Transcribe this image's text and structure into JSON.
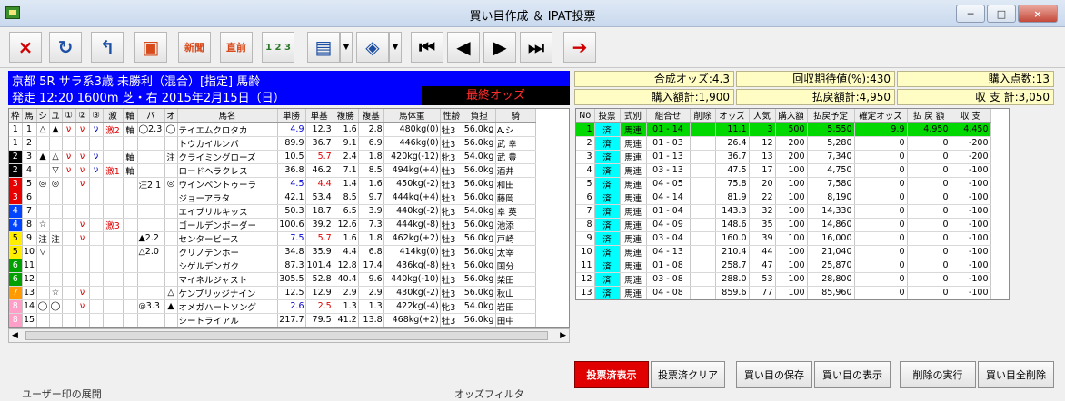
{
  "window": {
    "title": "買い目作成 ＆ IPAT投票",
    "minimize_label": "─",
    "maximize_label": "□",
    "close_label": "×"
  },
  "toolbar": {
    "close_glyph": "×",
    "refresh_glyph": "↻",
    "undo_glyph": "↰",
    "window_glyph": "▣",
    "shinbun_label": "新聞",
    "chokuzen_label": "直前",
    "list_label": "1 2 3",
    "doc_glyph": "▤",
    "dropdown_glyph": "▼",
    "bet_glyph": "◈",
    "first_glyph": "⏮",
    "prev_glyph": "◀",
    "next_glyph": "▶",
    "last_glyph": "⏭",
    "run_glyph": "➔"
  },
  "race": {
    "line1": "京都  5R  サラ系3歳  未勝利（混合）[指定]  馬齢",
    "line2": "発走  12:20  1600m  芝・右      2015年2月15日（日）",
    "odds_status": "最終オッズ"
  },
  "summary": {
    "gosei_odds": "合成オッズ:4.3",
    "kaishu": "回収期待値(%):430",
    "points": "購入点数:13",
    "total_buy": "購入額計:1,900",
    "total_refund": "払戻額計:4,950",
    "balance": "収 支 計:3,050"
  },
  "horse_table": {
    "headers": [
      "枠",
      "馬",
      "シ",
      "ユ",
      "①",
      "②",
      "③",
      "激",
      "軸",
      "バ",
      "オ",
      "馬名",
      "単勝",
      "単基",
      "複勝",
      "複基",
      "馬体重",
      "性齢",
      "負担",
      "騎"
    ],
    "rows": [
      {
        "waku": "1",
        "no": "1",
        "c1": "△",
        "c2": "▲",
        "c3": "ν",
        "c4": "ν",
        "c5": "ν",
        "geki": "激2",
        "jiku": "軸",
        "ba": "◯2.3",
        "o": "◯",
        "name": "テイエムクロタカ",
        "tan": "4.9",
        "tank": "12.3",
        "fuku": "1.6",
        "fukuk": "2.8",
        "weight": "480kg(0)",
        "sex": "牡3",
        "load": "56.0kg",
        "jockey": "A.シ"
      },
      {
        "waku": "1",
        "no": "2",
        "c1": "",
        "c2": "",
        "c3": "",
        "c4": "",
        "c5": "",
        "geki": "",
        "jiku": "",
        "ba": "",
        "o": "",
        "name": "トウカイルンバ",
        "tan": "89.9",
        "tank": "36.7",
        "fuku": "9.1",
        "fukuk": "6.9",
        "weight": "446kg(0)",
        "sex": "牡3",
        "load": "56.0kg",
        "jockey": "武 幸"
      },
      {
        "waku": "2",
        "no": "3",
        "c1": "▲",
        "c2": "△",
        "c3": "ν",
        "c4": "ν",
        "c5": "ν",
        "geki": "",
        "jiku": "軸",
        "ba": "",
        "o": "注",
        "name": "クライミングローズ",
        "tan": "10.5",
        "tank": "5.7",
        "fuku": "2.4",
        "fukuk": "1.8",
        "weight": "420kg(-12)",
        "sex": "牝3",
        "load": "54.0kg",
        "jockey": "武 豊"
      },
      {
        "waku": "2",
        "no": "4",
        "c1": "",
        "c2": "▽",
        "c3": "ν",
        "c4": "ν",
        "c5": "ν",
        "geki": "激1",
        "jiku": "軸",
        "ba": "",
        "o": "",
        "name": "ロードヘラクレス",
        "tan": "36.8",
        "tank": "46.2",
        "fuku": "7.1",
        "fukuk": "8.5",
        "weight": "494kg(+4)",
        "sex": "牡3",
        "load": "56.0kg",
        "jockey": "酒井"
      },
      {
        "waku": "3",
        "no": "5",
        "c1": "◎",
        "c2": "◎",
        "c3": "",
        "c4": "ν",
        "c5": "",
        "geki": "",
        "jiku": "",
        "ba": "注2.1",
        "o": "◎",
        "name": "ウインベントゥーラ",
        "tan": "4.5",
        "tank": "4.4",
        "fuku": "1.4",
        "fukuk": "1.6",
        "weight": "450kg(-2)",
        "sex": "牡3",
        "load": "56.0kg",
        "jockey": "和田"
      },
      {
        "waku": "3",
        "no": "6",
        "c1": "",
        "c2": "",
        "c3": "",
        "c4": "",
        "c5": "",
        "geki": "",
        "jiku": "",
        "ba": "",
        "o": "",
        "name": "ジョーアラタ",
        "tan": "42.1",
        "tank": "53.4",
        "fuku": "8.5",
        "fukuk": "9.7",
        "weight": "444kg(+4)",
        "sex": "牡3",
        "load": "56.0kg",
        "jockey": "藤岡"
      },
      {
        "waku": "4",
        "no": "7",
        "c1": "",
        "c2": "",
        "c3": "",
        "c4": "",
        "c5": "",
        "geki": "",
        "jiku": "",
        "ba": "",
        "o": "",
        "name": "エイブリルキッス",
        "tan": "50.3",
        "tank": "18.7",
        "fuku": "6.5",
        "fukuk": "3.9",
        "weight": "440kg(-2)",
        "sex": "牝3",
        "load": "54.0kg",
        "jockey": "幸 英"
      },
      {
        "waku": "4",
        "no": "8",
        "c1": "☆",
        "c2": "",
        "c3": "",
        "c4": "ν",
        "c5": "",
        "geki": "激3",
        "jiku": "",
        "ba": "",
        "o": "",
        "name": "ゴールデンボーダー",
        "tan": "100.6",
        "tank": "39.2",
        "fuku": "12.6",
        "fukuk": "7.3",
        "weight": "444kg(-8)",
        "sex": "牡3",
        "load": "56.0kg",
        "jockey": "池添"
      },
      {
        "waku": "5",
        "no": "9",
        "c1": "注",
        "c2": "注",
        "c3": "",
        "c4": "ν",
        "c5": "",
        "geki": "",
        "jiku": "",
        "ba": "▲2.2",
        "o": "",
        "name": "センタービース",
        "tan": "7.5",
        "tank": "5.7",
        "fuku": "1.6",
        "fukuk": "1.8",
        "weight": "462kg(+2)",
        "sex": "牡3",
        "load": "56.0kg",
        "jockey": "戸崎"
      },
      {
        "waku": "5",
        "no": "10",
        "c1": "▽",
        "c2": "",
        "c3": "",
        "c4": "",
        "c5": "",
        "geki": "",
        "jiku": "",
        "ba": "△2.0",
        "o": "",
        "name": "クリノテンホー",
        "tan": "34.8",
        "tank": "35.9",
        "fuku": "4.4",
        "fukuk": "6.8",
        "weight": "414kg(0)",
        "sex": "牡3",
        "load": "56.0kg",
        "jockey": "太宰"
      },
      {
        "waku": "6",
        "no": "11",
        "c1": "",
        "c2": "",
        "c3": "",
        "c4": "",
        "c5": "",
        "geki": "",
        "jiku": "",
        "ba": "",
        "o": "",
        "name": "シゲルデンガク",
        "tan": "87.3",
        "tank": "101.4",
        "fuku": "12.8",
        "fukuk": "17.4",
        "weight": "436kg(-8)",
        "sex": "牡3",
        "load": "56.0kg",
        "jockey": "国分"
      },
      {
        "waku": "6",
        "no": "12",
        "c1": "",
        "c2": "",
        "c3": "",
        "c4": "",
        "c5": "",
        "geki": "",
        "jiku": "",
        "ba": "",
        "o": "",
        "name": "マイネルジャスト",
        "tan": "305.5",
        "tank": "52.8",
        "fuku": "40.4",
        "fukuk": "9.6",
        "weight": "440kg(-10)",
        "sex": "牡3",
        "load": "56.0kg",
        "jockey": "柴田"
      },
      {
        "waku": "7",
        "no": "13",
        "c1": "",
        "c2": "☆",
        "c3": "",
        "c4": "ν",
        "c5": "",
        "geki": "",
        "jiku": "",
        "ba": "",
        "o": "△",
        "name": "ケンブリッジナイン",
        "tan": "12.5",
        "tank": "12.9",
        "fuku": "2.9",
        "fukuk": "2.9",
        "weight": "430kg(-2)",
        "sex": "牡3",
        "load": "56.0kg",
        "jockey": "秋山"
      },
      {
        "waku": "8",
        "no": "14",
        "c1": "◯",
        "c2": "◯",
        "c3": "",
        "c4": "ν",
        "c5": "",
        "geki": "",
        "jiku": "",
        "ba": "◎3.3",
        "o": "▲",
        "name": "オメガハートソング",
        "tan": "2.6",
        "tank": "2.5",
        "fuku": "1.3",
        "fukuk": "1.3",
        "weight": "422kg(-4)",
        "sex": "牝3",
        "load": "54.0kg",
        "jockey": "岩田"
      },
      {
        "waku": "8",
        "no": "15",
        "c1": "",
        "c2": "",
        "c3": "",
        "c4": "",
        "c5": "",
        "geki": "",
        "jiku": "",
        "ba": "",
        "o": "",
        "name": "シートライアル",
        "tan": "217.7",
        "tank": "79.5",
        "fuku": "41.2",
        "fukuk": "13.8",
        "weight": "468kg(+2)",
        "sex": "牡3",
        "load": "56.0kg",
        "jockey": "田中"
      }
    ]
  },
  "waku_colors": {
    "1": "#ffffff",
    "2": "#000000",
    "3": "#e60000",
    "4": "#0044ff",
    "5": "#ffee00",
    "6": "#00a000",
    "7": "#ff9a00",
    "8": "#ff9ec6"
  },
  "scroll": {
    "left": "◀",
    "right": "▶"
  },
  "bet_table": {
    "headers": [
      "No",
      "投票",
      "式別",
      "組合せ",
      "削除",
      "オッズ",
      "人気",
      "購入額",
      "払戻予定",
      "確定オッズ",
      "払 戻 額",
      "収  支"
    ],
    "rows": [
      {
        "no": "1",
        "vote": "済",
        "kind": "馬連",
        "combo": "01 - 14",
        "del": "",
        "odds": "11.1",
        "pop": "3",
        "buy": "500",
        "refund": "5,550",
        "fixed": "9.9",
        "paid": "4,950",
        "bal": "4,450"
      },
      {
        "no": "2",
        "vote": "済",
        "kind": "馬連",
        "combo": "01 - 03",
        "del": "",
        "odds": "26.4",
        "pop": "12",
        "buy": "200",
        "refund": "5,280",
        "fixed": "0",
        "paid": "0",
        "bal": "-200"
      },
      {
        "no": "3",
        "vote": "済",
        "kind": "馬連",
        "combo": "01 - 13",
        "del": "",
        "odds": "36.7",
        "pop": "13",
        "buy": "200",
        "refund": "7,340",
        "fixed": "0",
        "paid": "0",
        "bal": "-200"
      },
      {
        "no": "4",
        "vote": "済",
        "kind": "馬連",
        "combo": "03 - 13",
        "del": "",
        "odds": "47.5",
        "pop": "17",
        "buy": "100",
        "refund": "4,750",
        "fixed": "0",
        "paid": "0",
        "bal": "-100"
      },
      {
        "no": "5",
        "vote": "済",
        "kind": "馬連",
        "combo": "04 - 05",
        "del": "",
        "odds": "75.8",
        "pop": "20",
        "buy": "100",
        "refund": "7,580",
        "fixed": "0",
        "paid": "0",
        "bal": "-100"
      },
      {
        "no": "6",
        "vote": "済",
        "kind": "馬連",
        "combo": "04 - 14",
        "del": "",
        "odds": "81.9",
        "pop": "22",
        "buy": "100",
        "refund": "8,190",
        "fixed": "0",
        "paid": "0",
        "bal": "-100"
      },
      {
        "no": "7",
        "vote": "済",
        "kind": "馬連",
        "combo": "01 - 04",
        "del": "",
        "odds": "143.3",
        "pop": "32",
        "buy": "100",
        "refund": "14,330",
        "fixed": "0",
        "paid": "0",
        "bal": "-100"
      },
      {
        "no": "8",
        "vote": "済",
        "kind": "馬連",
        "combo": "04 - 09",
        "del": "",
        "odds": "148.6",
        "pop": "35",
        "buy": "100",
        "refund": "14,860",
        "fixed": "0",
        "paid": "0",
        "bal": "-100"
      },
      {
        "no": "9",
        "vote": "済",
        "kind": "馬連",
        "combo": "03 - 04",
        "del": "",
        "odds": "160.0",
        "pop": "39",
        "buy": "100",
        "refund": "16,000",
        "fixed": "0",
        "paid": "0",
        "bal": "-100"
      },
      {
        "no": "10",
        "vote": "済",
        "kind": "馬連",
        "combo": "04 - 13",
        "del": "",
        "odds": "210.4",
        "pop": "44",
        "buy": "100",
        "refund": "21,040",
        "fixed": "0",
        "paid": "0",
        "bal": "-100"
      },
      {
        "no": "11",
        "vote": "済",
        "kind": "馬連",
        "combo": "01 - 08",
        "del": "",
        "odds": "258.7",
        "pop": "47",
        "buy": "100",
        "refund": "25,870",
        "fixed": "0",
        "paid": "0",
        "bal": "-100"
      },
      {
        "no": "12",
        "vote": "済",
        "kind": "馬連",
        "combo": "03 - 08",
        "del": "",
        "odds": "288.0",
        "pop": "53",
        "buy": "100",
        "refund": "28,800",
        "fixed": "0",
        "paid": "0",
        "bal": "-100"
      },
      {
        "no": "13",
        "vote": "済",
        "kind": "馬連",
        "combo": "04 - 08",
        "del": "",
        "odds": "859.6",
        "pop": "77",
        "buy": "100",
        "refund": "85,960",
        "fixed": "0",
        "paid": "0",
        "bal": "-100"
      }
    ]
  },
  "buttons": {
    "show_voted": "投票済表示",
    "clear_voted": "投票済クリア",
    "save": "買い目の保存",
    "display": "買い目の表示",
    "execute_delete": "削除の実行",
    "delete_all": "買い目全削除"
  },
  "bottom": {
    "user_mark": "ユーザー印の展開",
    "filter": "オッズフィルタ"
  }
}
